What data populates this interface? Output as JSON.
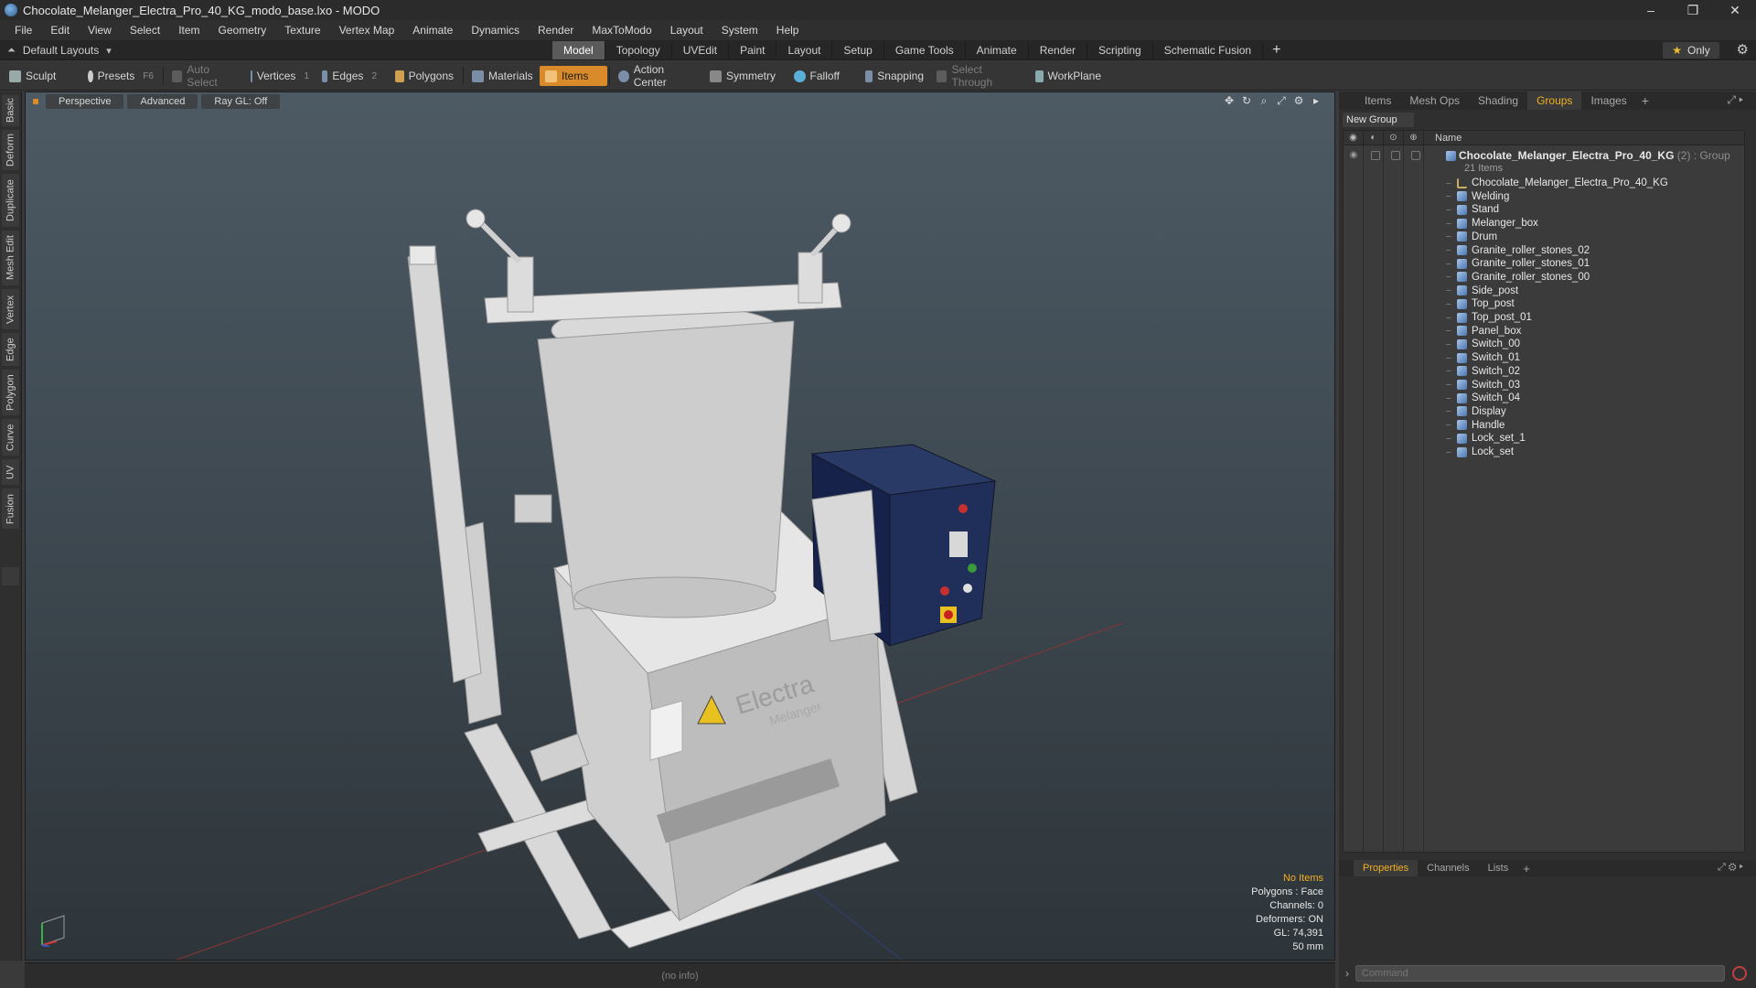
{
  "window": {
    "title": "Chocolate_Melanger_Electra_Pro_40_KG_modo_base.lxo - MODO",
    "controls": [
      "–",
      "❐",
      "✕"
    ]
  },
  "menu": [
    "File",
    "Edit",
    "View",
    "Select",
    "Item",
    "Geometry",
    "Texture",
    "Vertex Map",
    "Animate",
    "Dynamics",
    "Render",
    "MaxToModo",
    "Layout",
    "System",
    "Help"
  ],
  "layoutbar": {
    "default_layouts": "Default Layouts",
    "tabs": [
      "Model",
      "Topology",
      "UVEdit",
      "Paint",
      "Layout",
      "Setup",
      "Game Tools",
      "Animate",
      "Render",
      "Scripting",
      "Schematic Fusion"
    ],
    "active_tab": "Model",
    "plus": "+",
    "only": "Only"
  },
  "toolbar": {
    "sculpt": "Sculpt",
    "presets": "Presets",
    "presets_key": "F6",
    "auto_select": "Auto Select",
    "vertices": "Vertices",
    "vertices_key": "1",
    "edges": "Edges",
    "edges_key": "2",
    "polygons": "Polygons",
    "materials": "Materials",
    "items": "Items",
    "action_center": "Action Center",
    "symmetry": "Symmetry",
    "falloff": "Falloff",
    "snapping": "Snapping",
    "select_through": "Select Through",
    "workplane": "WorkPlane"
  },
  "left_tabs": [
    "Basic",
    "Deform",
    "Duplicate",
    "Mesh Edit",
    "Vertex",
    "Edge",
    "Polygon",
    "Curve",
    "UV",
    "Fusion"
  ],
  "viewport": {
    "view": "Perspective",
    "shading": "Advanced",
    "raygl": "Ray GL: Off",
    "info": {
      "no_items": "No Items",
      "polygons": "Polygons : Face",
      "channels": "Channels: 0",
      "deformers": "Deformers: ON",
      "gl": "GL: 74,391",
      "size": "50 mm"
    },
    "model_label": "Electra",
    "model_sublabel": "Melanger"
  },
  "status": "(no info)",
  "right_panel": {
    "tabs": [
      "Items",
      "Mesh Ops",
      "Shading",
      "Groups",
      "Images"
    ],
    "active_tab": "Groups",
    "new_group": "New Group",
    "col_name": "Name",
    "group": {
      "name": "Chocolate_Melanger_Electra_Pro_40_KG",
      "suffix": " (2) : Group",
      "count": "21 Items"
    },
    "items": [
      "Chocolate_Melanger_Electra_Pro_40_KG",
      "Welding",
      "Stand",
      "Melanger_box",
      "Drum",
      "Granite_roller_stones_02",
      "Granite_roller_stones_01",
      "Granite_roller_stones_00",
      "Side_post",
      "Top_post",
      "Top_post_01",
      "Panel_box",
      "Switch_00",
      "Switch_01",
      "Switch_02",
      "Switch_03",
      "Switch_04",
      "Display",
      "Handle",
      "Lock_set_1",
      "Lock_set"
    ]
  },
  "bottom_panel": {
    "tabs": [
      "Properties",
      "Channels",
      "Lists"
    ],
    "active_tab": "Properties",
    "command_placeholder": "Command"
  },
  "colors": {
    "accent": "#f0b020",
    "items_active": "#d98a2b",
    "panel_box": "#1f2f5a"
  }
}
